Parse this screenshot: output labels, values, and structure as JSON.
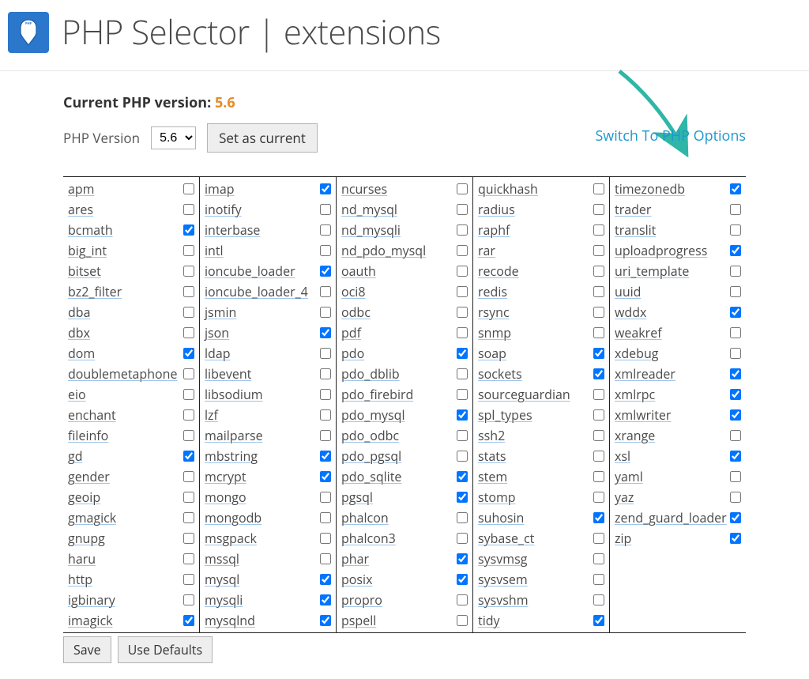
{
  "page_title": "PHP Selector | extensions",
  "current_version": {
    "label": "Current PHP version:",
    "value": "5.6"
  },
  "version_selector": {
    "label": "PHP Version",
    "selected": "5.6",
    "options": [
      "5.6"
    ],
    "set_button": "Set as current"
  },
  "switch_link": "Switch To PHP Options",
  "buttons": {
    "save": "Save",
    "use_defaults": "Use Defaults"
  },
  "columns": [
    [
      {
        "name": "apm",
        "checked": false
      },
      {
        "name": "ares",
        "checked": false
      },
      {
        "name": "bcmath",
        "checked": true
      },
      {
        "name": "big_int",
        "checked": false
      },
      {
        "name": "bitset",
        "checked": false
      },
      {
        "name": "bz2_filter",
        "checked": false
      },
      {
        "name": "dba",
        "checked": false
      },
      {
        "name": "dbx",
        "checked": false
      },
      {
        "name": "dom",
        "checked": true
      },
      {
        "name": "doublemetaphone",
        "checked": false
      },
      {
        "name": "eio",
        "checked": false
      },
      {
        "name": "enchant",
        "checked": false
      },
      {
        "name": "fileinfo",
        "checked": false
      },
      {
        "name": "gd",
        "checked": true
      },
      {
        "name": "gender",
        "checked": false
      },
      {
        "name": "geoip",
        "checked": false
      },
      {
        "name": "gmagick",
        "checked": false
      },
      {
        "name": "gnupg",
        "checked": false
      },
      {
        "name": "haru",
        "checked": false
      },
      {
        "name": "http",
        "checked": false
      },
      {
        "name": "igbinary",
        "checked": false
      },
      {
        "name": "imagick",
        "checked": true
      }
    ],
    [
      {
        "name": "imap",
        "checked": true
      },
      {
        "name": "inotify",
        "checked": false
      },
      {
        "name": "interbase",
        "checked": false
      },
      {
        "name": "intl",
        "checked": false
      },
      {
        "name": "ioncube_loader",
        "checked": true
      },
      {
        "name": "ioncube_loader_4",
        "checked": false
      },
      {
        "name": "jsmin",
        "checked": false
      },
      {
        "name": "json",
        "checked": true
      },
      {
        "name": "ldap",
        "checked": false
      },
      {
        "name": "libevent",
        "checked": false
      },
      {
        "name": "libsodium",
        "checked": false
      },
      {
        "name": "lzf",
        "checked": false
      },
      {
        "name": "mailparse",
        "checked": false
      },
      {
        "name": "mbstring",
        "checked": true
      },
      {
        "name": "mcrypt",
        "checked": true
      },
      {
        "name": "mongo",
        "checked": false
      },
      {
        "name": "mongodb",
        "checked": false
      },
      {
        "name": "msgpack",
        "checked": false
      },
      {
        "name": "mssql",
        "checked": false
      },
      {
        "name": "mysql",
        "checked": true
      },
      {
        "name": "mysqli",
        "checked": true
      },
      {
        "name": "mysqlnd",
        "checked": true
      }
    ],
    [
      {
        "name": "ncurses",
        "checked": false
      },
      {
        "name": "nd_mysql",
        "checked": false
      },
      {
        "name": "nd_mysqli",
        "checked": false
      },
      {
        "name": "nd_pdo_mysql",
        "checked": false
      },
      {
        "name": "oauth",
        "checked": false
      },
      {
        "name": "oci8",
        "checked": false
      },
      {
        "name": "odbc",
        "checked": false
      },
      {
        "name": "pdf",
        "checked": false
      },
      {
        "name": "pdo",
        "checked": true
      },
      {
        "name": "pdo_dblib",
        "checked": false
      },
      {
        "name": "pdo_firebird",
        "checked": false
      },
      {
        "name": "pdo_mysql",
        "checked": true
      },
      {
        "name": "pdo_odbc",
        "checked": false
      },
      {
        "name": "pdo_pgsql",
        "checked": false
      },
      {
        "name": "pdo_sqlite",
        "checked": true
      },
      {
        "name": "pgsql",
        "checked": true
      },
      {
        "name": "phalcon",
        "checked": false
      },
      {
        "name": "phalcon3",
        "checked": false
      },
      {
        "name": "phar",
        "checked": true
      },
      {
        "name": "posix",
        "checked": true
      },
      {
        "name": "propro",
        "checked": false
      },
      {
        "name": "pspell",
        "checked": false
      }
    ],
    [
      {
        "name": "quickhash",
        "checked": false
      },
      {
        "name": "radius",
        "checked": false
      },
      {
        "name": "raphf",
        "checked": false
      },
      {
        "name": "rar",
        "checked": false
      },
      {
        "name": "recode",
        "checked": false
      },
      {
        "name": "redis",
        "checked": false
      },
      {
        "name": "rsync",
        "checked": false
      },
      {
        "name": "snmp",
        "checked": false
      },
      {
        "name": "soap",
        "checked": true
      },
      {
        "name": "sockets",
        "checked": true
      },
      {
        "name": "sourceguardian",
        "checked": false
      },
      {
        "name": "spl_types",
        "checked": false
      },
      {
        "name": "ssh2",
        "checked": false
      },
      {
        "name": "stats",
        "checked": false
      },
      {
        "name": "stem",
        "checked": false
      },
      {
        "name": "stomp",
        "checked": false
      },
      {
        "name": "suhosin",
        "checked": true
      },
      {
        "name": "sybase_ct",
        "checked": false
      },
      {
        "name": "sysvmsg",
        "checked": false
      },
      {
        "name": "sysvsem",
        "checked": false
      },
      {
        "name": "sysvshm",
        "checked": false
      },
      {
        "name": "tidy",
        "checked": true
      }
    ],
    [
      {
        "name": "timezonedb",
        "checked": true
      },
      {
        "name": "trader",
        "checked": false
      },
      {
        "name": "translit",
        "checked": false
      },
      {
        "name": "uploadprogress",
        "checked": true
      },
      {
        "name": "uri_template",
        "checked": false
      },
      {
        "name": "uuid",
        "checked": false
      },
      {
        "name": "wddx",
        "checked": true
      },
      {
        "name": "weakref",
        "checked": false
      },
      {
        "name": "xdebug",
        "checked": false
      },
      {
        "name": "xmlreader",
        "checked": true
      },
      {
        "name": "xmlrpc",
        "checked": true
      },
      {
        "name": "xmlwriter",
        "checked": true
      },
      {
        "name": "xrange",
        "checked": false
      },
      {
        "name": "xsl",
        "checked": true
      },
      {
        "name": "yaml",
        "checked": false
      },
      {
        "name": "yaz",
        "checked": false
      },
      {
        "name": "zend_guard_loader",
        "checked": true
      },
      {
        "name": "zip",
        "checked": true
      }
    ]
  ]
}
